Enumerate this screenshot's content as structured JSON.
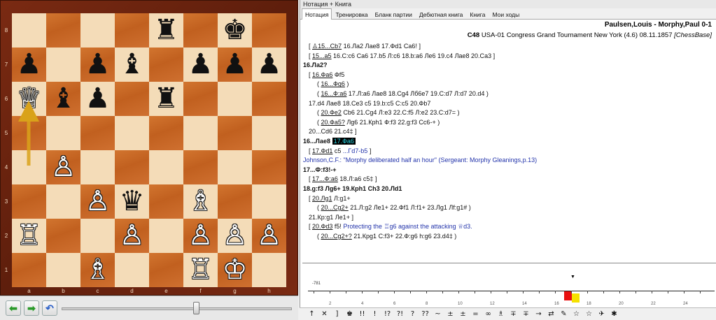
{
  "window": {
    "title": "Нотация + Книга"
  },
  "tabs": [
    "Нотация",
    "Тренировка",
    "Бланк партии",
    "Дебютная книга",
    "Книга",
    "Мои ходы"
  ],
  "game": {
    "players": "Paulsen,Louis - Morphy,Paul  0-1",
    "eco": "C48",
    "event": "USA-01 Congress Grand Tournament New York (4.6) 08.11.1857",
    "source": "[ChessBase]"
  },
  "board": {
    "files": [
      "a",
      "b",
      "c",
      "d",
      "e",
      "f",
      "g",
      "h"
    ],
    "ranks": [
      "8",
      "7",
      "6",
      "5",
      "4",
      "3",
      "2",
      "1"
    ],
    "squares": [
      [
        "",
        "",
        "",
        "",
        "r",
        "",
        "k",
        ""
      ],
      [
        "p",
        "",
        "p",
        "b",
        "",
        "p",
        "p",
        "p"
      ],
      [
        "Q",
        "b",
        "p",
        "",
        "r",
        "",
        "",
        ""
      ],
      [
        "",
        "",
        "",
        "",
        "",
        "",
        "",
        ""
      ],
      [
        "",
        "P",
        "",
        "",
        "",
        "",
        "",
        ""
      ],
      [
        "",
        "",
        "P",
        "q",
        "",
        "B",
        "",
        ""
      ],
      [
        "R",
        "",
        "",
        "P",
        "",
        "P",
        "P",
        "P"
      ],
      [
        "",
        "",
        "B",
        "",
        "",
        "R",
        "K",
        ""
      ]
    ],
    "glyphs": {
      "K": "♔",
      "Q": "♕",
      "R": "♖",
      "B": "♗",
      "N": "♘",
      "P": "♙",
      "k": "♚",
      "q": "♛",
      "r": "♜",
      "b": "♝",
      "n": "♞",
      "p": "♟"
    },
    "arrow_color": "#d9a21a"
  },
  "nav": {
    "back": "⬅",
    "forward": "➡",
    "undo": "↶"
  },
  "notation": [
    {
      "indent": "ind1",
      "parts": [
        [
          "[ "
        ],
        [
          "♙15...Cb7",
          "ul"
        ],
        [
          "  16.Ла2  Лае8  17.Фd1  Са6! ]"
        ]
      ]
    },
    {
      "indent": "ind1",
      "parts": [
        [
          "[ "
        ],
        [
          "15...a5",
          "ul"
        ],
        [
          "  16.С:с6  Са6  17.b5  Л:с6  18.b:а6  Ле6  19.с4  Лае8  20.Са3 ]"
        ]
      ]
    },
    {
      "indent": "ind0",
      "parts": [
        [
          "16.Ла2?",
          "bold"
        ]
      ]
    },
    {
      "indent": "ind1",
      "parts": [
        [
          "[ "
        ],
        [
          "16.Фа6",
          "ul"
        ],
        [
          "  Фf5"
        ]
      ]
    },
    {
      "indent": "ind2",
      "parts": [
        [
          "( "
        ],
        [
          "16...Фg6",
          "ul"
        ],
        [
          " )"
        ]
      ]
    },
    {
      "indent": "ind2",
      "parts": [
        [
          "( "
        ],
        [
          "16...Ф:а6",
          "ul"
        ],
        [
          "  17.Л:а6  Лае8  18.Сg4  Лб6е7  19.С:d7  Л:d7  20.d4 )"
        ]
      ]
    },
    {
      "indent": "ind1",
      "parts": [
        [
          "17.d4  Лае8  18.Сe3  c5  19.b:с5  С:с5  20.Фb7"
        ]
      ]
    },
    {
      "indent": "ind2",
      "parts": [
        [
          "( "
        ],
        [
          "20.Фe2",
          "ul"
        ],
        [
          "  Cb6  21.Cg4  Л:e3  22.C:f5  Л:e2  23.C:d7= )"
        ]
      ]
    },
    {
      "indent": "ind2",
      "parts": [
        [
          "( "
        ],
        [
          "20.Фа5?",
          "ul"
        ],
        [
          "  Лg6  21.Крh1  Ф:f3  22.g:f3  Cс6-+ )"
        ]
      ]
    },
    {
      "indent": "ind1",
      "parts": [
        [
          "20...Cd6  21.c4‡ ]"
        ]
      ]
    },
    {
      "indent": "ind0",
      "parts": [
        [
          "16...Лае8  ",
          "bold"
        ],
        [
          "17.Фа6",
          "hl"
        ]
      ]
    },
    {
      "indent": "ind1",
      "parts": [
        [
          "[ "
        ],
        [
          "17.Фd1",
          "ul"
        ],
        [
          "  c5  "
        ],
        [
          "...Гd7-b5",
          "blue"
        ],
        [
          "  ]"
        ]
      ]
    },
    {
      "indent": "ind0",
      "parts": [
        [
          "Johnson,C.F.: \"Morphy deliberated half an hour\" (Sergeant: Morphy Gleanings,p.13)",
          "blue"
        ]
      ]
    },
    {
      "indent": "ind0",
      "parts": [
        [
          "17...Ф:f3!-+",
          "bold"
        ]
      ]
    },
    {
      "indent": "ind1",
      "parts": [
        [
          "[ "
        ],
        [
          "17...Ф:а6",
          "ul"
        ],
        [
          "  18.Л:а6  c5‡ ]"
        ]
      ]
    },
    {
      "indent": "ind0",
      "parts": [
        [
          "18.g:f3  Лg6+  19.Крh1  Сh3  20.Лd1",
          "bold"
        ]
      ]
    },
    {
      "indent": "ind1",
      "parts": [
        [
          "[ "
        ],
        [
          "20.Лg1",
          "ul"
        ],
        [
          "  Л:g1+"
        ]
      ]
    },
    {
      "indent": "ind2",
      "parts": [
        [
          "( "
        ],
        [
          "20...Cg2+",
          "ul"
        ],
        [
          "  21.Л:g2  Ле1+  22.Фf1  Л:f1+  23.Лg1  Лf:g1# )"
        ]
      ]
    },
    {
      "indent": "ind1",
      "parts": [
        [
          "21.Кр:g1  Ле1+ ]"
        ]
      ]
    },
    {
      "indent": "ind1",
      "parts": [
        [
          "[ "
        ],
        [
          "20.Фd3",
          "ul"
        ],
        [
          "  f5! "
        ],
        [
          "Protecting the ♖g6 against the attacking ♕d3.",
          "blue"
        ]
      ]
    },
    {
      "indent": "ind2",
      "parts": [
        [
          "( "
        ],
        [
          "20...Cg2+?",
          "ul"
        ],
        [
          "  21.Крg1  C:f3+  22.Ф:g6  h:g6  23.d4‡ )"
        ]
      ]
    }
  ],
  "graph": {
    "label": "-781",
    "ticks": [
      "2",
      "4",
      "6",
      "8",
      "10",
      "12",
      "14",
      "16",
      "18",
      "20",
      "22",
      "24"
    ]
  },
  "symbols": [
    "↑",
    "✕",
    "]",
    "♚",
    "!!",
    "!",
    "!?",
    "?!",
    "?",
    "??",
    "~",
    "±",
    "±",
    "=",
    "∞",
    "♗",
    "∓",
    "∓",
    "→",
    "⇄",
    "✎",
    "☆",
    "☆",
    "✈",
    "✱"
  ],
  "colors": {
    "eval_white": "#f5e100",
    "eval_black": "#e81010",
    "highlight_text": "#29d3e0"
  }
}
